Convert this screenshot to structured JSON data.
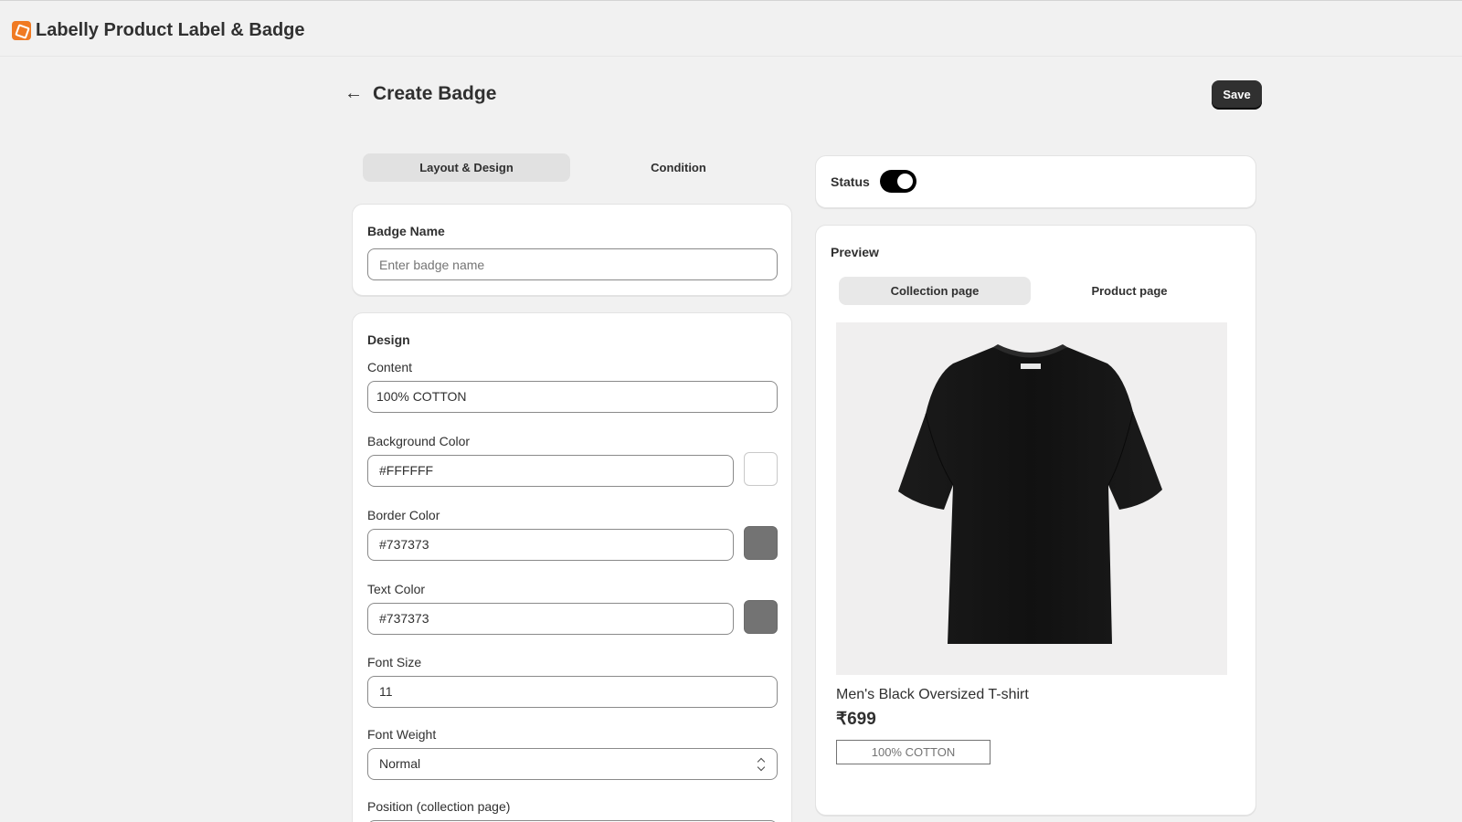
{
  "app": {
    "title": "Labelly Product Label & Badge",
    "logo_icon": "labelly-logo-icon",
    "logo_color": "#f07a23"
  },
  "header": {
    "back_icon": "arrow-left-icon",
    "back_glyph": "←",
    "title": "Create Badge",
    "save_label": "Save"
  },
  "tabs": [
    {
      "label": "Layout & Design",
      "active": true
    },
    {
      "label": "Condition",
      "active": false
    }
  ],
  "badge_name": {
    "title": "Badge Name",
    "value": "",
    "placeholder": "Enter badge name"
  },
  "design": {
    "title": "Design",
    "content": {
      "label": "Content",
      "value": "100%  COTTON"
    },
    "background_color": {
      "label": "Background Color",
      "value": "#FFFFFF",
      "swatch": "#FFFFFF"
    },
    "border_color": {
      "label": "Border Color",
      "value": "#737373",
      "swatch": "#737373"
    },
    "text_color": {
      "label": "Text Color",
      "value": "#737373",
      "swatch": "#737373"
    },
    "font_size": {
      "label": "Font Size",
      "value": "11"
    },
    "font_weight": {
      "label": "Font Weight",
      "value": "Normal"
    },
    "position": {
      "label": "Position (collection page)"
    }
  },
  "status": {
    "label": "Status",
    "enabled": true
  },
  "preview": {
    "title": "Preview",
    "tabs": [
      {
        "label": "Collection page",
        "active": true
      },
      {
        "label": "Product page",
        "active": false
      }
    ],
    "product": {
      "image_icon": "black-tshirt-image",
      "name": "Men's Black Oversized T-shirt",
      "price": "₹699",
      "badge_text": "100%  COTTON"
    }
  }
}
